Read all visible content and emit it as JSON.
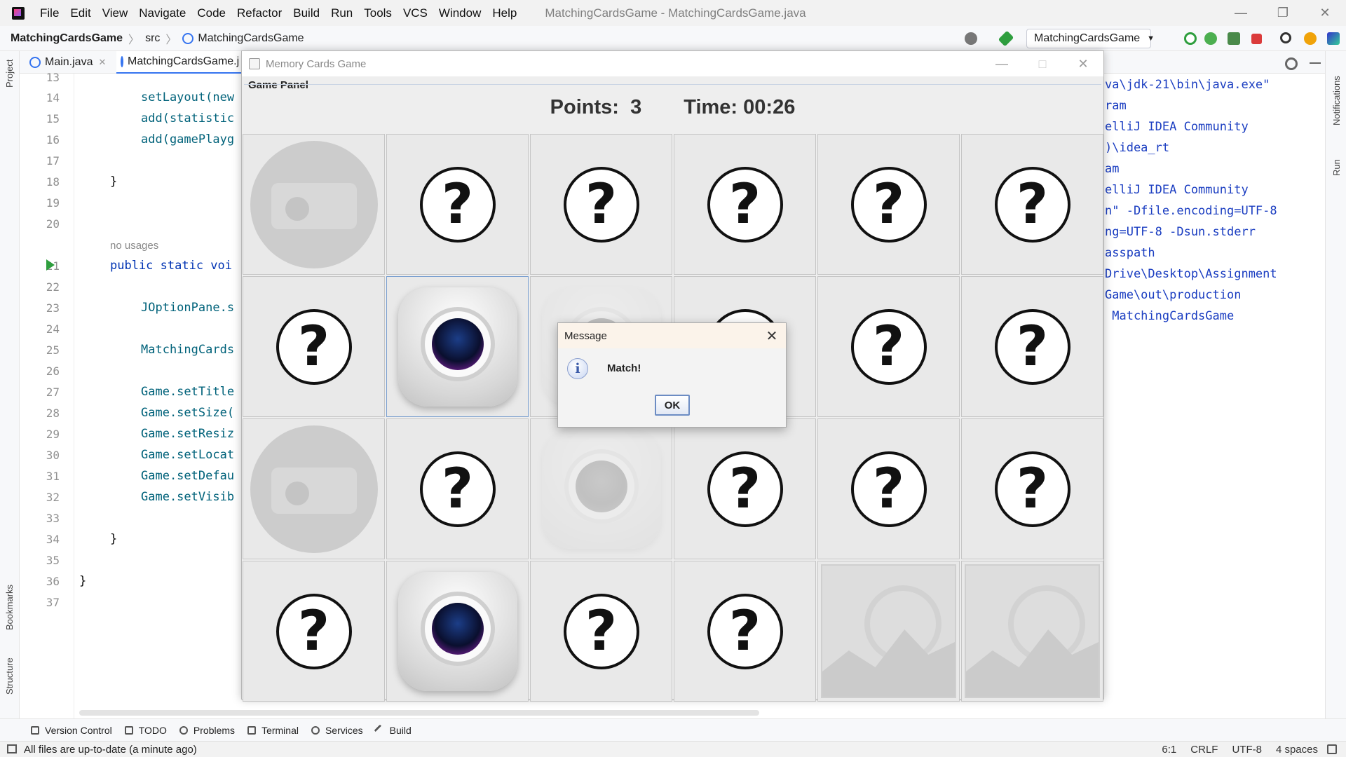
{
  "menubar": {
    "items": [
      "File",
      "Edit",
      "View",
      "Navigate",
      "Code",
      "Refactor",
      "Build",
      "Run",
      "Tools",
      "VCS",
      "Window",
      "Help"
    ],
    "window_title": "MatchingCardsGame - MatchingCardsGame.java"
  },
  "navbar": {
    "project": "MatchingCardsGame",
    "folder": "src",
    "file": "MatchingCardsGame",
    "run_config": "MatchingCardsGame"
  },
  "tabs": [
    {
      "label": "Main.java"
    },
    {
      "label": "MatchingCardsGame.j"
    }
  ],
  "left_tools": {
    "project": "Project",
    "bookmarks": "Bookmarks",
    "structure": "Structure"
  },
  "right_tools": {
    "notifications": "Notifications",
    "run": "Run"
  },
  "editor": {
    "line_numbers": [
      "13",
      "14",
      "15",
      "16",
      "17",
      "18",
      "19",
      "20",
      "21",
      "22",
      "23",
      "24",
      "25",
      "26",
      "27",
      "28",
      "29",
      "30",
      "31",
      "32",
      "33",
      "34",
      "35",
      "36",
      "37"
    ],
    "usage_hint": "no usages",
    "lines": {
      "l14": "setLayout(new",
      "l15": "add(statistic",
      "l16": "add(gamePlayg",
      "l18": "}",
      "l21a": "public static voi",
      "l23": "JOptionPane.s",
      "l25": "MatchingCards",
      "l27": "Game.setTitle",
      "l28": "Game.setSize(",
      "l29": "Game.setResiz",
      "l30": "Game.setLocat",
      "l31": "Game.setDefau",
      "l32": "Game.setVisib",
      "l34": "}",
      "l36": "}"
    }
  },
  "console": {
    "lines": [
      "va\\jdk-21\\bin\\java.exe\"",
      "ram",
      "elliJ IDEA Community",
      ")\\idea_rt",
      "am",
      "elliJ IDEA Community",
      "n\" -Dfile.encoding=UTF-8",
      "ng=UTF-8 -Dsun.stderr",
      "asspath",
      "Drive\\Desktop\\Assignment",
      "Game\\out\\production",
      " MatchingCardsGame"
    ]
  },
  "game": {
    "title": "Memory Cards Game",
    "panel_label": "Game Panel",
    "points_label": "Points:",
    "points": "3",
    "time_label": "Time:",
    "time": "00:26",
    "cards": [
      "dim-camera",
      "question",
      "question",
      "question",
      "question",
      "question",
      "question",
      "camera-selected",
      "dim-webcam",
      "question",
      "question",
      "question",
      "dim-camera",
      "question",
      "dim-webcam",
      "question",
      "question",
      "question",
      "question",
      "camera",
      "question",
      "question",
      "dim-photo",
      "dim-photo"
    ]
  },
  "dialog": {
    "title": "Message",
    "message": "Match!",
    "ok": "OK",
    "icon": "info-icon"
  },
  "bottom_tools": [
    "Version Control",
    "TODO",
    "Problems",
    "Terminal",
    "Services",
    "Build"
  ],
  "status": {
    "message": "All files are up-to-date (a minute ago)",
    "position": "6:1",
    "line_sep": "CRLF",
    "encoding": "UTF-8",
    "indent": "4 spaces"
  },
  "colors": {
    "accent": "#3574f0",
    "keyword": "#0033b3",
    "run_green": "#2e9e3e"
  }
}
